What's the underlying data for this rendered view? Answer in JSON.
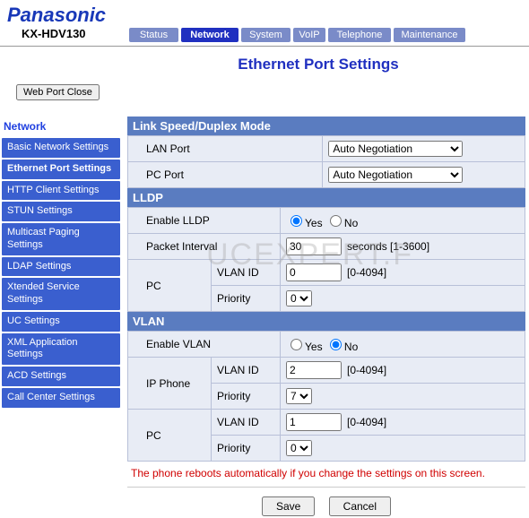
{
  "brand": "Panasonic",
  "model": "KX-HDV130",
  "watermark": "UCEXPERT.F",
  "tabs": {
    "status": "Status",
    "network": "Network",
    "system": "System",
    "voip": "VoIP",
    "telephone": "Telephone",
    "maintenance": "Maintenance"
  },
  "page_title": "Ethernet Port Settings",
  "webport_btn": "Web Port Close",
  "sidebar": {
    "heading": "Network",
    "items": [
      "Basic Network Settings",
      "Ethernet Port Settings",
      "HTTP Client Settings",
      "STUN Settings",
      "Multicast Paging Settings",
      "LDAP Settings",
      "Xtended Service Settings",
      "UC Settings",
      "XML Application Settings",
      "ACD Settings",
      "Call Center Settings"
    ]
  },
  "sections": {
    "link": {
      "title": "Link Speed/Duplex Mode",
      "lan_label": "LAN Port",
      "lan_value": "Auto Negotiation",
      "pc_label": "PC Port",
      "pc_value": "Auto Negotiation"
    },
    "lldp": {
      "title": "LLDP",
      "enable_label": "Enable LLDP",
      "enable_value": "Yes",
      "yes": "Yes",
      "no": "No",
      "packet_label": "Packet Interval",
      "packet_value": "30",
      "packet_hint": "seconds [1-3600]",
      "pc_label": "PC",
      "vlan_label": "VLAN ID",
      "vlan_value": "0",
      "vlan_hint": "[0-4094]",
      "prio_label": "Priority",
      "prio_value": "0"
    },
    "vlan": {
      "title": "VLAN",
      "enable_label": "Enable VLAN",
      "enable_value": "No",
      "yes": "Yes",
      "no": "No",
      "ip_label": "IP Phone",
      "ip_vlan_label": "VLAN ID",
      "ip_vlan_value": "2",
      "ip_vlan_hint": "[0-4094]",
      "ip_prio_label": "Priority",
      "ip_prio_value": "7",
      "pc_label": "PC",
      "pc_vlan_label": "VLAN ID",
      "pc_vlan_value": "1",
      "pc_vlan_hint": "[0-4094]",
      "pc_prio_label": "Priority",
      "pc_prio_value": "0"
    }
  },
  "warning": "The phone reboots automatically if you change the settings on this screen.",
  "buttons": {
    "save": "Save",
    "cancel": "Cancel"
  }
}
